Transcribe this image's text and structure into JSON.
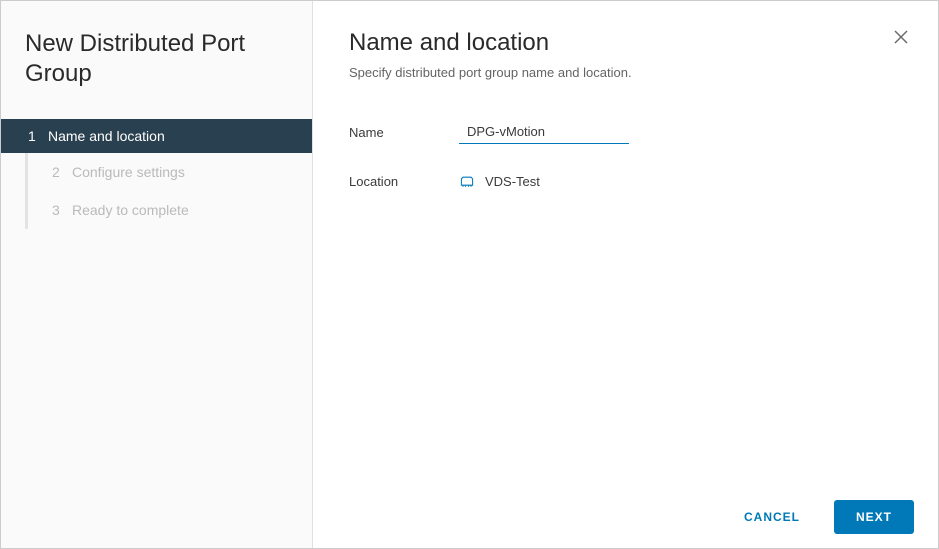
{
  "sidebar": {
    "title": "New Distributed Port Group",
    "steps": [
      {
        "num": "1",
        "label": "Name and location",
        "active": true
      },
      {
        "num": "2",
        "label": "Configure settings",
        "active": false
      },
      {
        "num": "3",
        "label": "Ready to complete",
        "active": false
      }
    ]
  },
  "panel": {
    "title": "Name and location",
    "subtitle": "Specify distributed port group name and location."
  },
  "form": {
    "name_label": "Name",
    "name_value": "DPG-vMotion",
    "location_label": "Location",
    "location_value": "VDS-Test"
  },
  "footer": {
    "cancel": "CANCEL",
    "next": "NEXT"
  }
}
